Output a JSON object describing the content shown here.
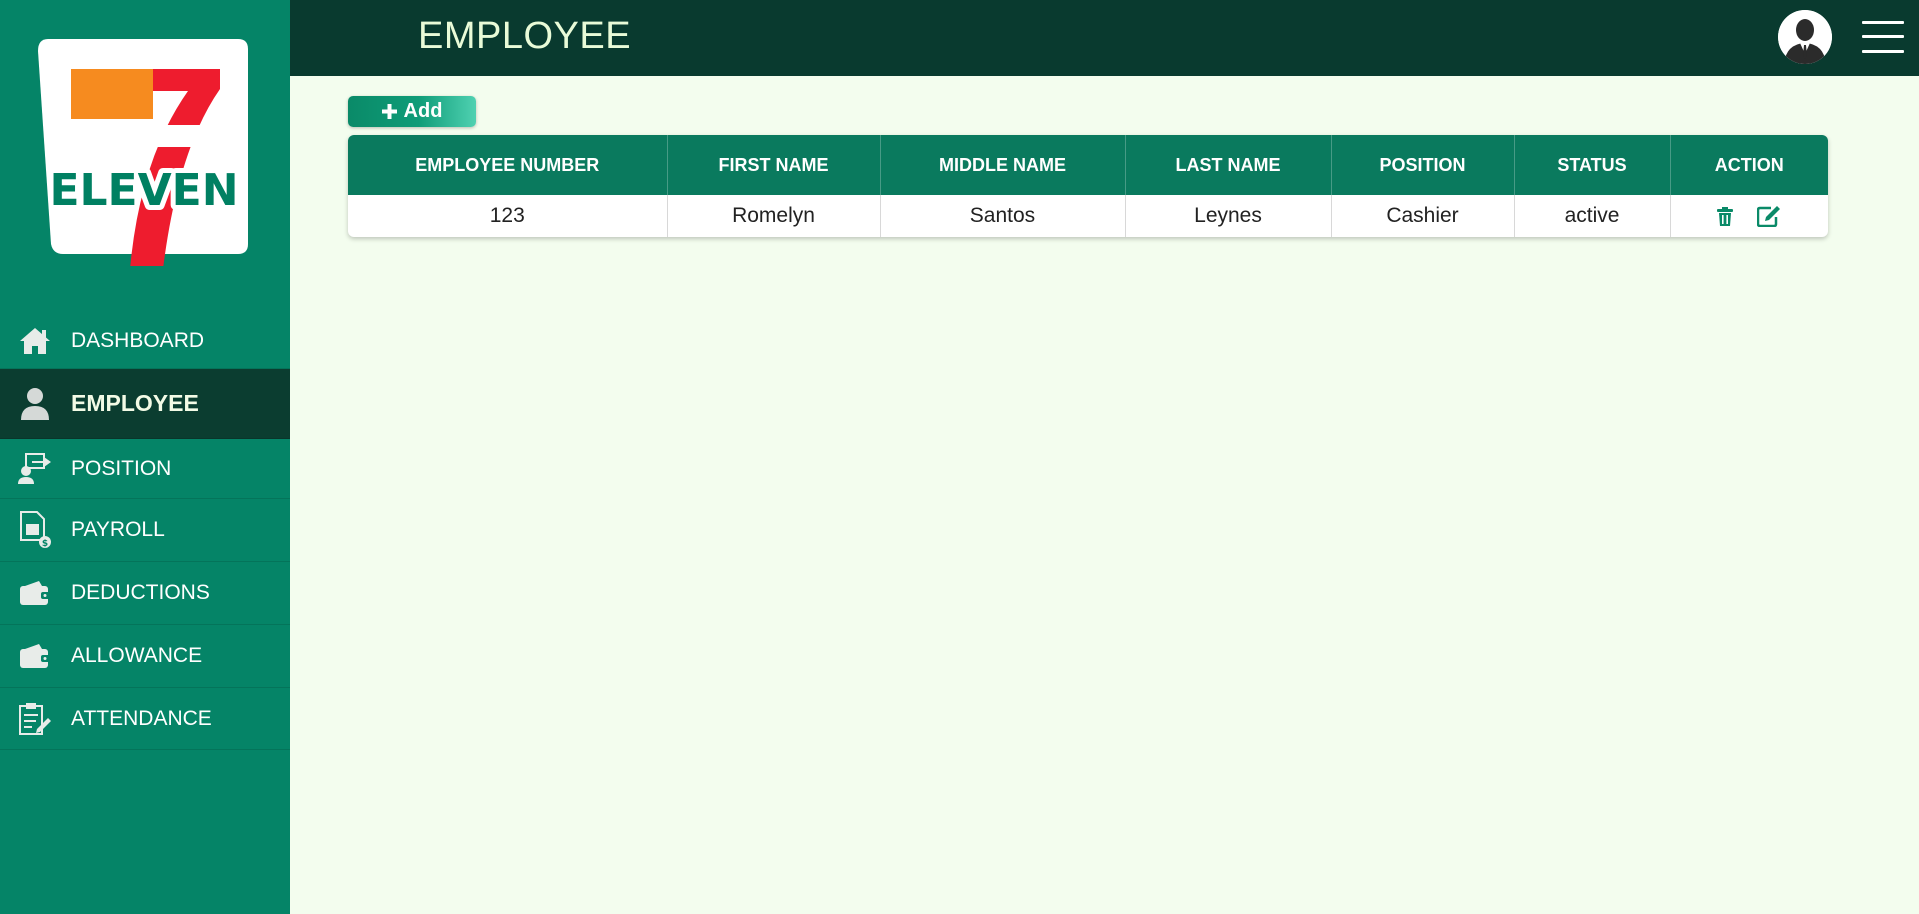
{
  "header": {
    "title": "EMPLOYEE"
  },
  "brand": {
    "logo_text": "ELEVEN",
    "logo_numeral": "7"
  },
  "sidebar": {
    "items": [
      {
        "label": "DASHBOARD",
        "icon": "home-icon"
      },
      {
        "label": "EMPLOYEE",
        "icon": "user-icon",
        "active": true
      },
      {
        "label": "POSITION",
        "icon": "user-transfer-icon"
      },
      {
        "label": "PAYROLL",
        "icon": "payroll-document-icon"
      },
      {
        "label": "DEDUCTIONS",
        "icon": "wallet-icon"
      },
      {
        "label": "ALLOWANCE",
        "icon": "wallet-icon"
      },
      {
        "label": "ATTENDANCE",
        "icon": "clipboard-edit-icon"
      }
    ]
  },
  "toolbar": {
    "add_label": "Add"
  },
  "table": {
    "columns": [
      "EMPLOYEE NUMBER",
      "FIRST NAME",
      "MIDDLE NAME",
      "LAST NAME",
      "POSITION",
      "STATUS",
      "ACTION"
    ],
    "rows": [
      {
        "employee_number": "123",
        "first_name": "Romelyn",
        "middle_name": "Santos",
        "last_name": "Leynes",
        "position": "Cashier",
        "status": "active"
      }
    ]
  },
  "colors": {
    "sidebar": "#058467",
    "sidebar_active": "#0b3d30",
    "topbar": "#093a2f",
    "content_bg": "#f3fdee",
    "table_header": "#0a7a5e",
    "action_icon": "#0a8a68",
    "logo_orange": "#f68b1f",
    "logo_red": "#ee1c2e",
    "logo_green": "#008062"
  }
}
